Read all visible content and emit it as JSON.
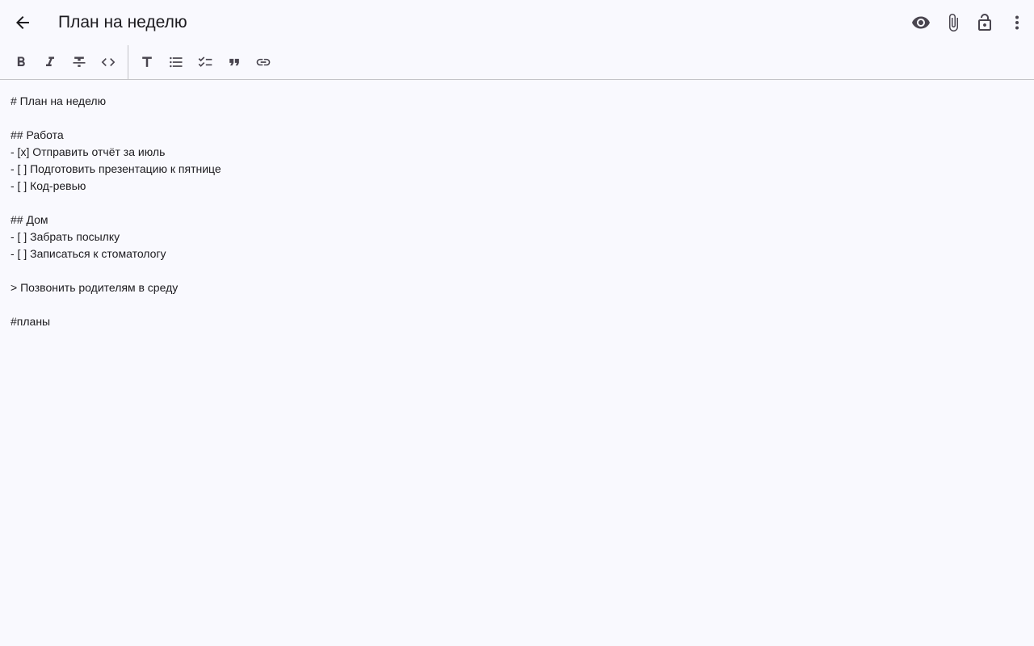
{
  "note": {
    "title": "План на неделю",
    "lines": [
      "# План на неделю",
      "",
      "## Работа",
      "- [x] Отправить отчёт за июль",
      "- [ ] Подготовить презентацию к пятнице",
      "- [ ] Код-ревью",
      "",
      "## Дом",
      "- [ ] Забрать посылку",
      "- [ ] Записаться к стоматологу",
      "",
      "> Позвонить родителям в среду",
      "",
      "#планы"
    ]
  },
  "appbar": {
    "back_icon": "arrow-back-icon",
    "actions": [
      "eye-icon",
      "paperclip-icon",
      "lock-open-icon",
      "more-vert-icon"
    ]
  },
  "toolbar": {
    "buttons": [
      "bold-icon",
      "italic-icon",
      "strikethrough-icon",
      "code-icon",
      "heading-icon",
      "bullet-list-icon",
      "checklist-icon",
      "quote-icon",
      "link-icon"
    ]
  },
  "colors": {
    "background": "#f9f9fe",
    "text": "#1c1b1f",
    "icon": "#49454f",
    "divider": "#c4c4c8"
  }
}
